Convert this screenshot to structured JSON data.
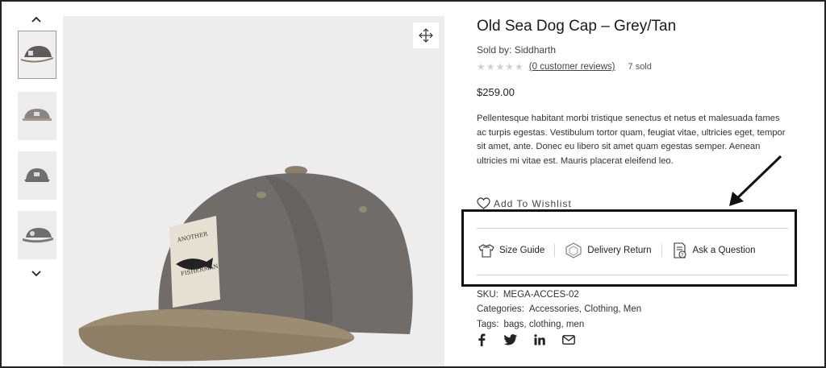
{
  "product": {
    "title": "Old Sea Dog Cap – Grey/Tan",
    "sold_by": "Sold by: Siddharth",
    "stars": "★★★★★",
    "reviews_link": "(0 customer reviews)",
    "sold_count": "7 sold",
    "price": "$259.00",
    "description": "Pellentesque habitant morbi tristique senectus et netus et malesuada fames ac turpis egestas. Vestibulum tortor quam, feugiat vitae, ultricies eget, tempor sit amet, ante. Donec eu libero sit amet quam egestas semper. Aenean ultricies mi vitae est. Mauris placerat eleifend leo.",
    "wishlist_label": "Add To Wishlist"
  },
  "tools": {
    "size_guide": "Size Guide",
    "delivery_return": "Delivery Return",
    "ask_question": "Ask a Question"
  },
  "meta": {
    "sku_label": "SKU:",
    "sku_value": "MEGA-ACCES-02",
    "categories_label": "Categories:",
    "categories_value": "Accessories, Clothing, Men",
    "tags_label": "Tags:",
    "tags_value": "bags, clothing, men"
  },
  "patch_text": {
    "line1": "ANOTHER",
    "line2": "FISHERMAN"
  },
  "icons": {
    "thumb_up": "chevron-up-icon",
    "thumb_down": "chevron-down-icon",
    "zoom": "move-arrows-icon",
    "wishlist": "heart-icon",
    "size_guide": "shirt-icon",
    "delivery": "delivery-box-icon",
    "question": "document-question-icon",
    "facebook": "facebook-icon",
    "twitter": "twitter-icon",
    "linkedin": "linkedin-icon",
    "email": "mail-icon"
  },
  "colors": {
    "cap_body": "#6e6b68",
    "cap_brim": "#9a8a72",
    "highlight_border": "#111111",
    "stars": "#cfcfcf"
  }
}
